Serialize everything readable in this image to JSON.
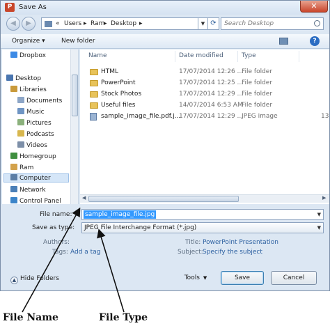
{
  "window": {
    "title": "Save As",
    "app_icon_letter": "P"
  },
  "address": {
    "crumbs": [
      "«",
      "Users",
      "Ram",
      "Desktop"
    ],
    "search_placeholder": "Search Desktop"
  },
  "toolbar": {
    "organize": "Organize ▾",
    "new_folder": "New folder",
    "help": "?"
  },
  "nav_pane": {
    "items": [
      {
        "label": "Dropbox",
        "color": "#3d8ae5"
      },
      {
        "label": "Desktop",
        "color": "#4a76b0"
      },
      {
        "label": "Libraries",
        "color": "#c99a3b"
      },
      {
        "label": "Documents",
        "color": "#8da6c7"
      },
      {
        "label": "Music",
        "color": "#6f95c4"
      },
      {
        "label": "Pictures",
        "color": "#8bb17c"
      },
      {
        "label": "Podcasts",
        "color": "#d8b74e"
      },
      {
        "label": "Videos",
        "color": "#7d8fa8"
      },
      {
        "label": "Homegroup",
        "color": "#3f8f3f"
      },
      {
        "label": "Ram",
        "color": "#d3a24b"
      },
      {
        "label": "Computer",
        "color": "#5c7ea6"
      },
      {
        "label": "Network",
        "color": "#4b7fb7"
      },
      {
        "label": "Control Panel",
        "color": "#3b84c9"
      }
    ]
  },
  "file_list": {
    "columns": [
      "Name",
      "Date modified",
      "Type"
    ],
    "rows": [
      {
        "name": "HTML",
        "date": "17/07/2014 12:26 ...",
        "type": "File folder",
        "icon": "folder",
        "size": ""
      },
      {
        "name": "PowerPoint",
        "date": "17/07/2014 12:25 ...",
        "type": "File folder",
        "icon": "folder",
        "size": ""
      },
      {
        "name": "Stock Photos",
        "date": "17/07/2014 12:29 ...",
        "type": "File folder",
        "icon": "folder",
        "size": ""
      },
      {
        "name": "Useful files",
        "date": "14/07/2014 6:53 AM",
        "type": "File folder",
        "icon": "folder",
        "size": ""
      },
      {
        "name": "sample_image_file.pdf.j...",
        "date": "17/07/2014 12:29 ...",
        "type": "JPEG image",
        "icon": "image",
        "size": "13"
      }
    ]
  },
  "form": {
    "file_name_label": "File name:",
    "file_name_value": "sample_image_file.jpg",
    "save_as_type_label": "Save as type:",
    "save_as_type_value": "JPEG File Interchange Format (*.jpg)",
    "authors_label": "Authors:",
    "tags_label": "Tags:",
    "tags_link": "Add a tag",
    "title_label": "Title:",
    "title_value": "PowerPoint Presentation",
    "subject_label": "Subject:",
    "subject_link": "Specify the subject"
  },
  "footer": {
    "hide_folders": "Hide Folders",
    "tools": "Tools",
    "save": "Save",
    "cancel": "Cancel"
  },
  "annotations": {
    "file_name": "File Name",
    "file_type": "File Type"
  }
}
